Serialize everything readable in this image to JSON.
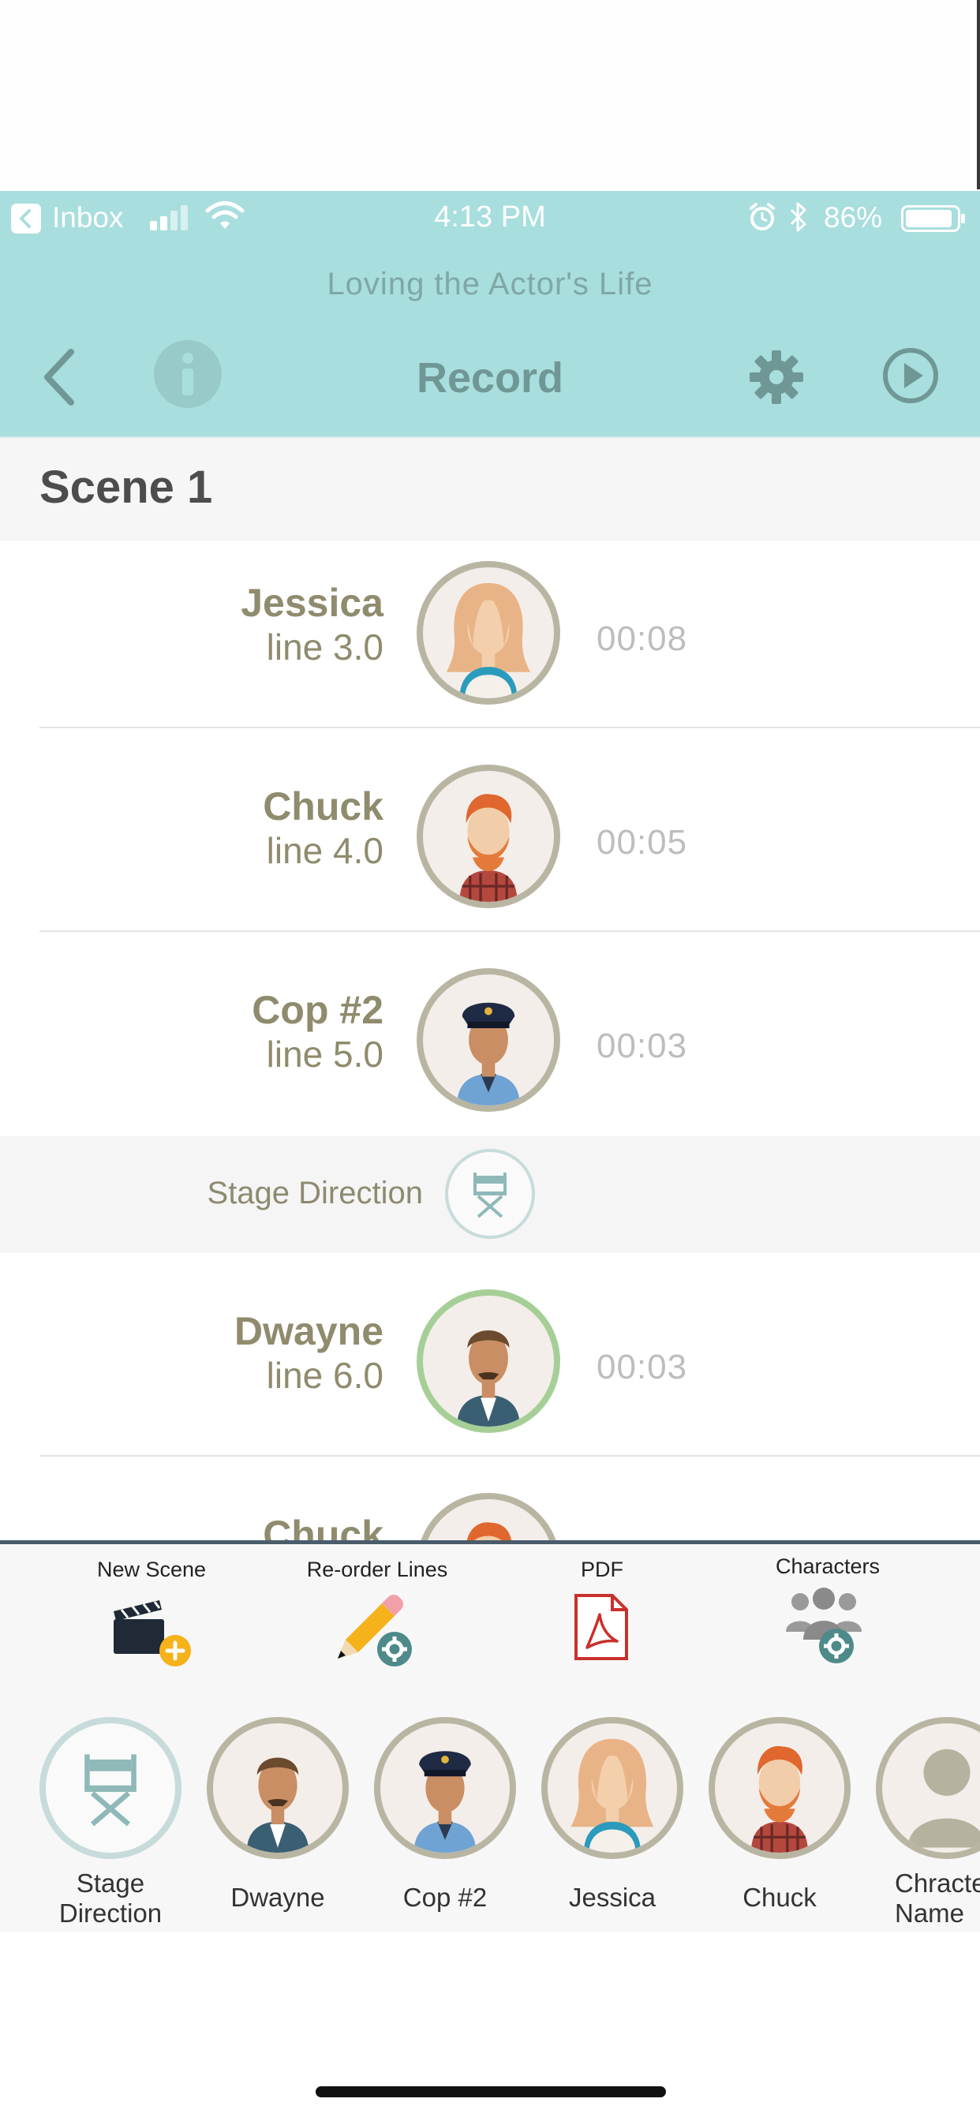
{
  "status_bar": {
    "carrier": "Inbox",
    "time": "4:13 PM",
    "battery_pct": "86%"
  },
  "header": {
    "subtitle": "Loving the Actor's Life",
    "title": "Record"
  },
  "scene": {
    "title": "Scene 1"
  },
  "rows": [
    {
      "name": "Jessica",
      "line": "line 3.0",
      "duration": "00:08",
      "avatar": "jessica-avatar"
    },
    {
      "name": "Chuck",
      "line": "line 4.0",
      "duration": "00:05",
      "avatar": "chuck-avatar"
    },
    {
      "name": "Cop #2",
      "line": "line 5.0",
      "duration": "00:03",
      "avatar": "cop-avatar"
    },
    {
      "name": "Dwayne",
      "line": "line 6.0",
      "duration": "00:03",
      "avatar": "dwayne-avatar"
    },
    {
      "name": "Chuck"
    }
  ],
  "stage_direction_row": {
    "label": "Stage Direction"
  },
  "toolbar": {
    "new_scene": "New Scene",
    "reorder_lines": "Re-order Lines",
    "pdf": "PDF",
    "characters": "Characters"
  },
  "cast": [
    {
      "line1": "Stage",
      "line2": "Direction"
    },
    {
      "line1": "Dwayne"
    },
    {
      "line1": "Cop #2"
    },
    {
      "line1": "Jessica"
    },
    {
      "line1": "Chuck"
    },
    {
      "line1": "Chracte",
      "line2": "Name"
    }
  ],
  "colors": {
    "header_bg": "#a8dedd",
    "name_text": "#8f8b6d",
    "avatar_border": "#b8b5a2",
    "active_avatar_border": "#a5cf96",
    "pdf_red": "#c9302c",
    "add_badge": "#f5b21a"
  }
}
